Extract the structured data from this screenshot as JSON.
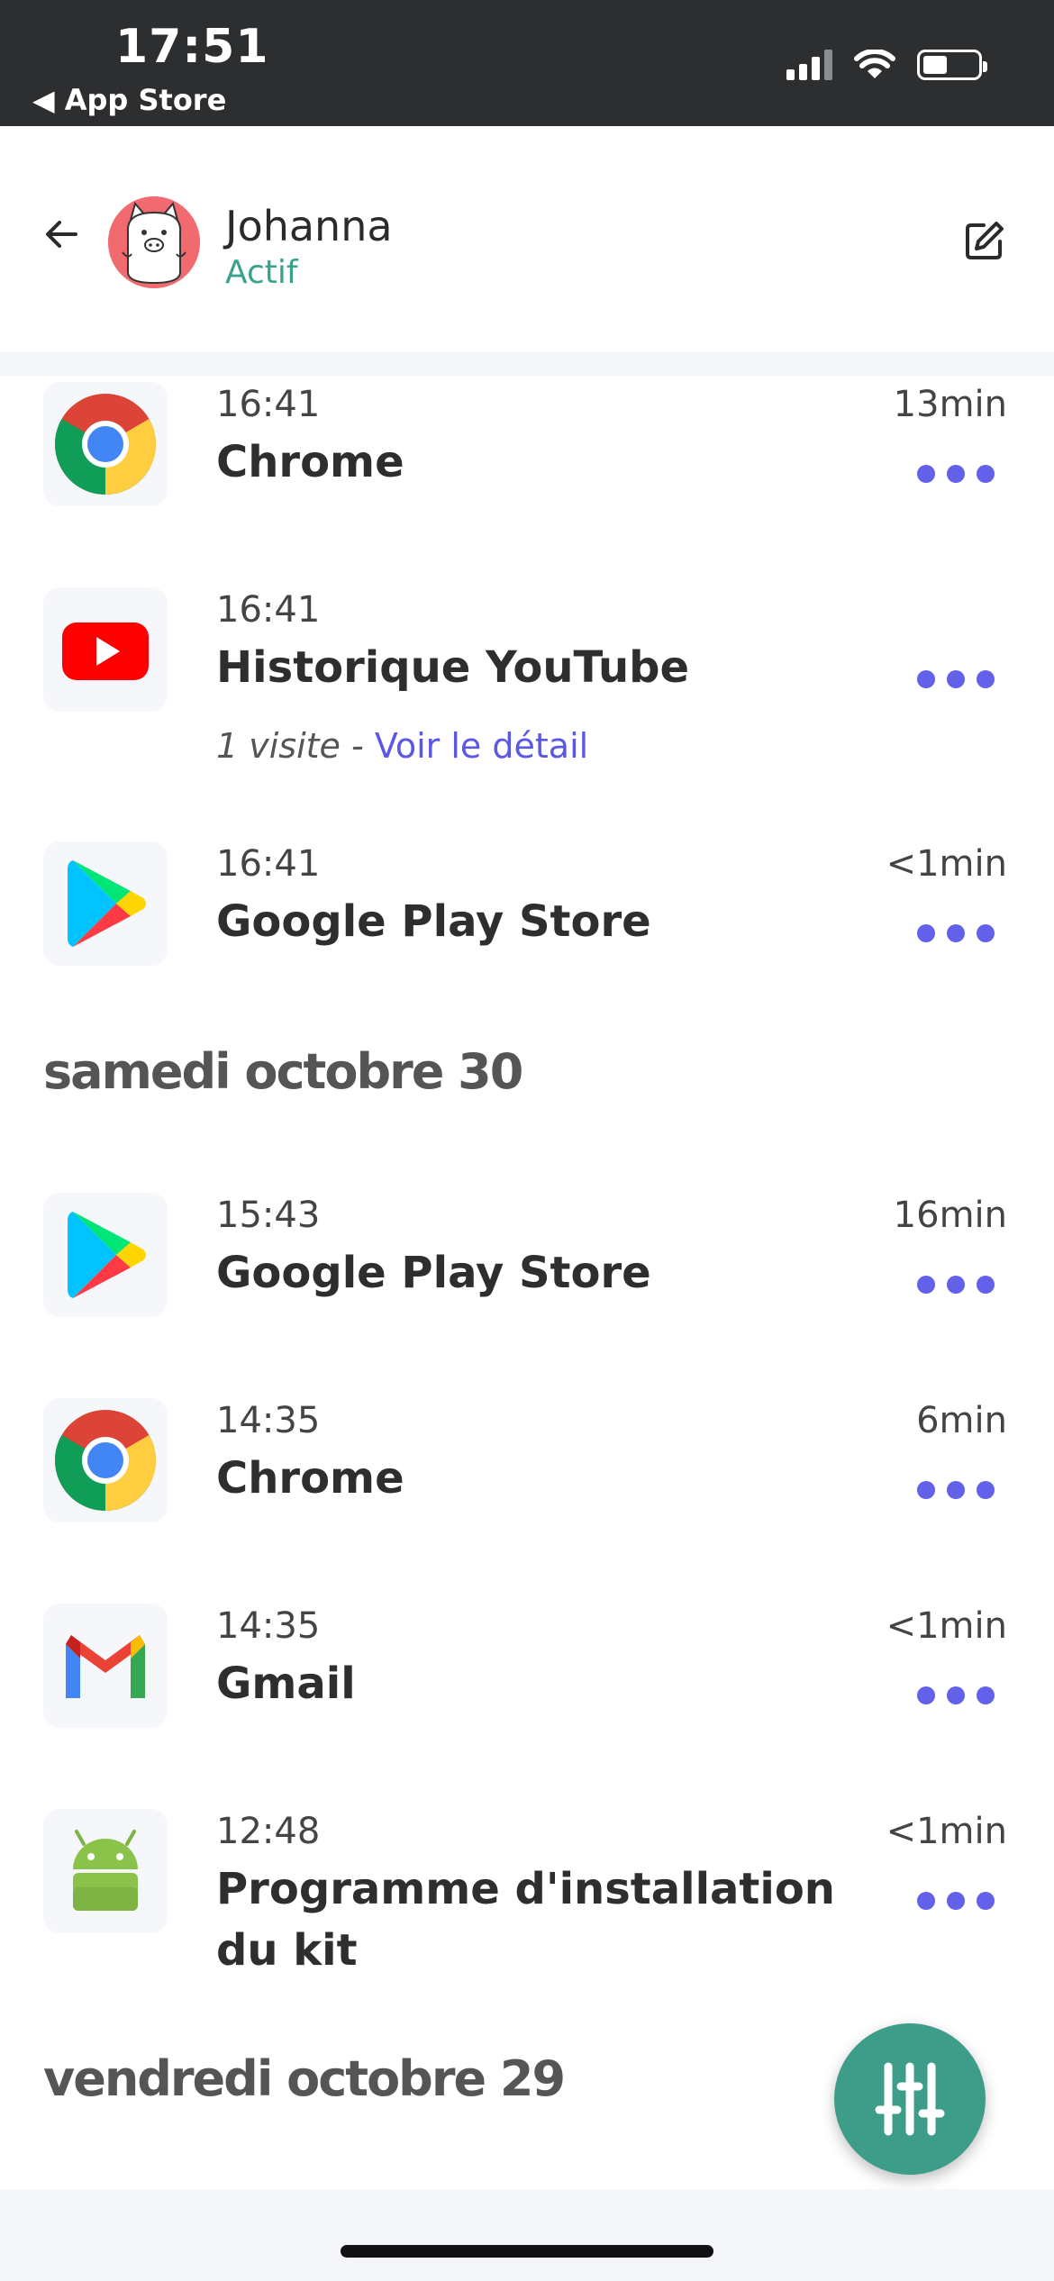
{
  "status_bar": {
    "time": "17:51",
    "back_label": "◀ App Store"
  },
  "header": {
    "name": "Johanna",
    "status": "Actif"
  },
  "sections": {
    "today_items": [
      {
        "time": "16:41",
        "title": "Chrome",
        "duration": "13min",
        "icon": "chrome-icon"
      },
      {
        "time": "16:41",
        "title": "Historique YouTube",
        "duration": "",
        "icon": "youtube-icon",
        "visit_count": "1 visite",
        "visit_sep": " - ",
        "visit_link": "Voir le détail"
      },
      {
        "time": "16:41",
        "title": "Google Play Store",
        "duration": "<1min",
        "icon": "play-store-icon"
      }
    ],
    "day2_label": "samedi octobre 30",
    "day2_items": [
      {
        "time": "15:43",
        "title": "Google Play Store",
        "duration": "16min",
        "icon": "play-store-icon"
      },
      {
        "time": "14:35",
        "title": "Chrome",
        "duration": "6min",
        "icon": "chrome-icon"
      },
      {
        "time": "14:35",
        "title": "Gmail",
        "duration": "<1min",
        "icon": "gmail-icon"
      },
      {
        "time": "12:48",
        "title_line1": "Programme d'installation",
        "title_line2": "du kit",
        "duration": "<1min",
        "icon": "android-icon"
      }
    ],
    "day3_label": "vendredi octobre 29"
  },
  "colors": {
    "accent": "#6360e9",
    "status_green": "#3aa28c",
    "fab": "#3d9d89"
  }
}
